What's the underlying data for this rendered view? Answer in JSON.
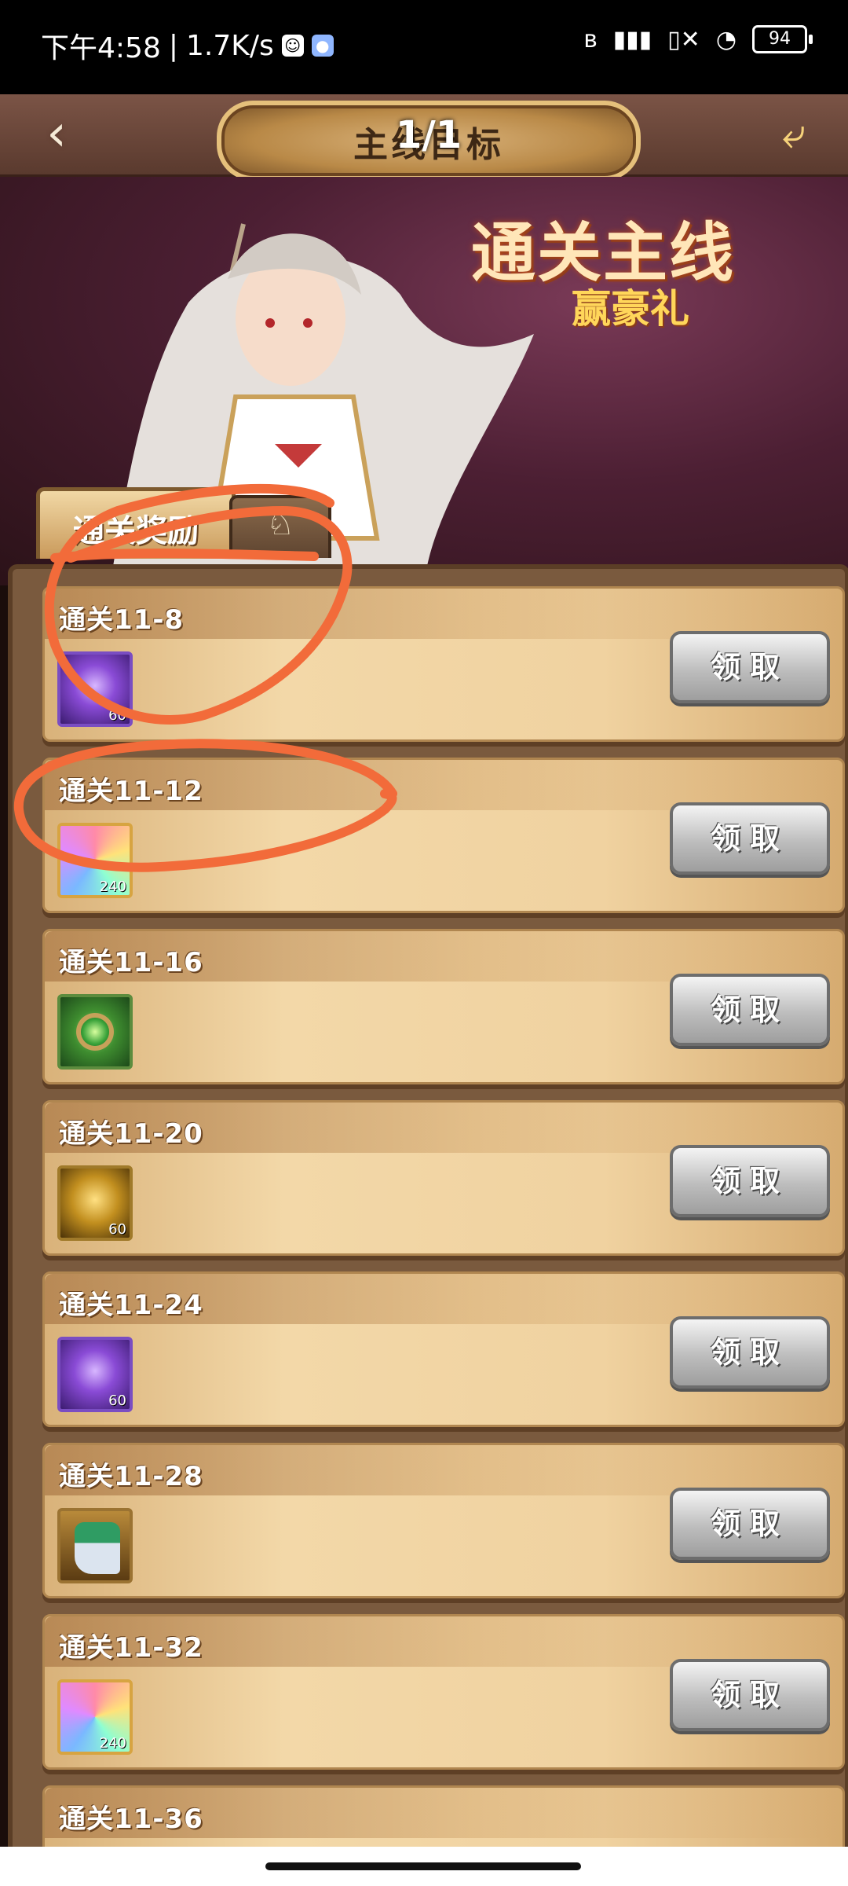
{
  "status_bar": {
    "time": "下午4:58",
    "speed": "1.7K/s",
    "battery": "94",
    "icons": [
      "ghost-icon",
      "app-notification-icon",
      "bluetooth-icon",
      "signal-icon",
      "signal-no-icon",
      "wifi-icon",
      "battery-icon"
    ]
  },
  "app_bar": {
    "back_icon": "back-arrow-icon",
    "title": "主线目标",
    "counter": "1/1",
    "share_icon": "share-icon"
  },
  "banner": {
    "title": "通关主线",
    "subtitle": "赢豪礼"
  },
  "tabs": [
    {
      "label": "通关奖励",
      "active": true
    },
    {
      "label": "♘",
      "active": false
    }
  ],
  "rewards": [
    {
      "title": "通关11-8",
      "item_icon": "purple-crystal-icon",
      "count": "60",
      "button": "领取"
    },
    {
      "title": "通关11-12",
      "item_icon": "rainbow-crystal-icon",
      "count": "240",
      "button": "领取"
    },
    {
      "title": "通关11-16",
      "item_icon": "green-orb-icon",
      "count": "",
      "button": "领取"
    },
    {
      "title": "通关11-20",
      "item_icon": "gold-crystal-icon",
      "count": "60",
      "button": "领取"
    },
    {
      "title": "通关11-24",
      "item_icon": "purple-crystal-icon",
      "count": "60",
      "button": "领取"
    },
    {
      "title": "通关11-28",
      "item_icon": "boots-icon",
      "count": "",
      "button": "领取"
    },
    {
      "title": "通关11-32",
      "item_icon": "rainbow-crystal-icon",
      "count": "240",
      "button": "领取"
    },
    {
      "title": "通关11-36",
      "item_icon": "",
      "count": "",
      "button": ""
    }
  ],
  "colors": {
    "annotation": "#f26b3a",
    "accent_gold": "#e5c07b",
    "button_gray": "#bdbdbd"
  }
}
